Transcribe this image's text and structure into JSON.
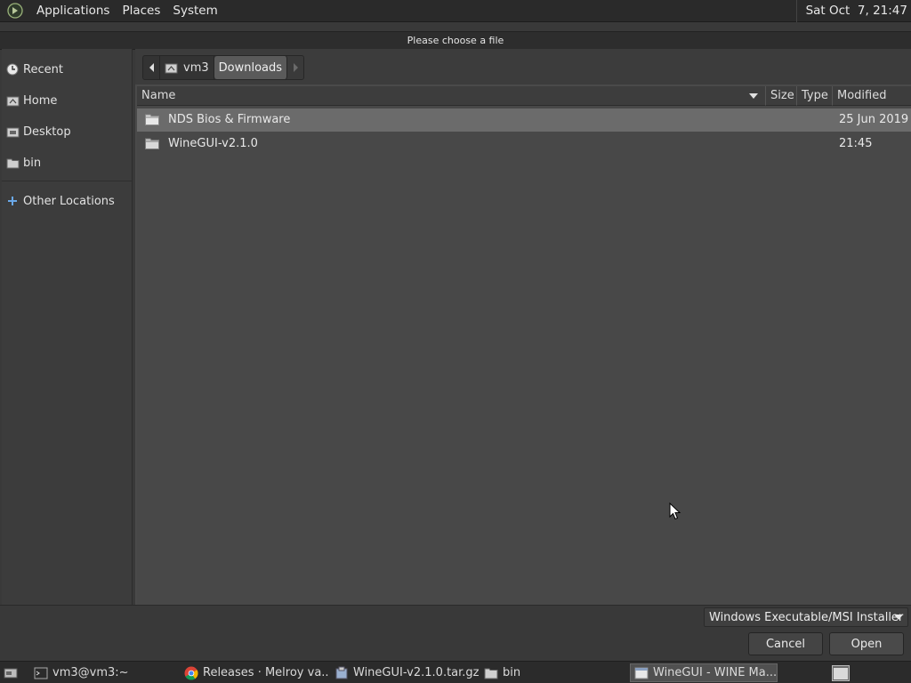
{
  "top_panel": {
    "menus": [
      "Applications",
      "Places",
      "System"
    ],
    "clock": "Sat Oct  7, 21:47"
  },
  "dialog": {
    "title": "Please choose a file",
    "sidebar": {
      "items": [
        {
          "label": "Recent",
          "icon": "clock-icon"
        },
        {
          "label": "Home",
          "icon": "home-icon"
        },
        {
          "label": "Desktop",
          "icon": "desktop-icon"
        },
        {
          "label": "bin",
          "icon": "folder-icon"
        },
        {
          "label": "Other Locations",
          "icon": "plus-icon"
        }
      ]
    },
    "pathbar": {
      "crumbs": [
        "vm3",
        "Downloads"
      ],
      "active": "Downloads"
    },
    "columns": {
      "name": "Name",
      "size": "Size",
      "type": "Type",
      "modified": "Modified"
    },
    "files": [
      {
        "name": "NDS Bios & Firmware",
        "size": "",
        "type": "",
        "modified": "25 Jun 2019",
        "selected": true
      },
      {
        "name": "WineGUI-v2.1.0",
        "size": "",
        "type": "",
        "modified": "21:45",
        "selected": false
      }
    ],
    "filter": "Windows Executable/MSI Installer",
    "buttons": {
      "cancel": "Cancel",
      "open": "Open"
    }
  },
  "taskbar": {
    "tasks": [
      {
        "label": "vm3@vm3:~",
        "icon": "terminal-icon",
        "active": false
      },
      {
        "label": "Releases · Melroy va...",
        "icon": "chrome-icon",
        "active": false
      },
      {
        "label": "WineGUI-v2.1.0.tar.gz",
        "icon": "archive-icon",
        "active": false
      },
      {
        "label": "bin",
        "icon": "folder-icon",
        "active": false
      },
      {
        "label": "WineGUI - WINE Ma...",
        "icon": "window-icon",
        "active": true
      }
    ]
  },
  "colors": {
    "panel": "#2a2a2a",
    "dialog_bg": "#393939",
    "list_bg": "#484848",
    "selection": "#6b6b6b"
  }
}
